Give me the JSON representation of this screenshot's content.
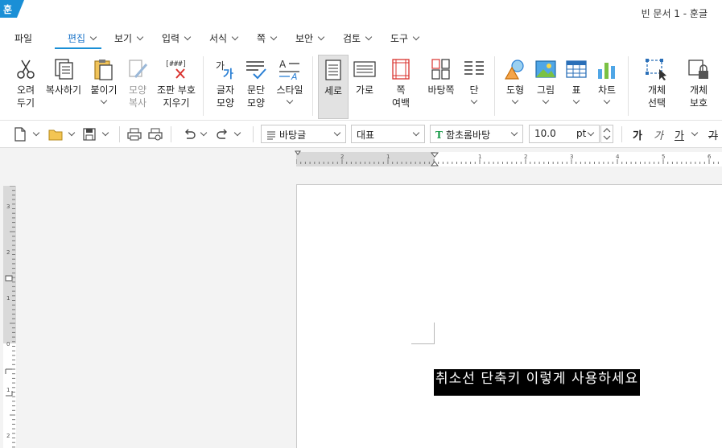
{
  "app": {
    "logo_text": "훈",
    "window_title": "빈 문서 1 - 훈글"
  },
  "menu": {
    "file": "파일",
    "items": [
      "편집",
      "보기",
      "입력",
      "서식",
      "쪽",
      "보안",
      "검토",
      "도구"
    ],
    "active": "편집"
  },
  "ribbon": {
    "cut": [
      "오려",
      "두기"
    ],
    "copy": "복사하기",
    "paste": "붙이기",
    "format_copy": [
      "모양",
      "복사"
    ],
    "clear_marks": [
      "조판 부호",
      "지우기"
    ],
    "clear_marks_icon_text": "[###]",
    "char_shape": [
      "글자",
      "모양"
    ],
    "char_icon_text": "가",
    "para_shape": [
      "문단",
      "모양"
    ],
    "style": "스타일",
    "portrait": "세로",
    "landscape": "가로",
    "page_margin": [
      "쪽",
      "여백"
    ],
    "background": "바탕쪽",
    "columns": "단",
    "shapes": "도형",
    "picture": "그림",
    "table": "표",
    "chart": "차트",
    "object_select": [
      "개체",
      "선택"
    ],
    "object_protect": [
      "개체",
      "보호"
    ]
  },
  "toolbar": {
    "style_combo": "바탕글",
    "lang_combo": "대표",
    "font_combo": "함초롬바탕",
    "size_value": "10.0",
    "size_unit": "pt",
    "bold": "가",
    "italic": "가",
    "underline": "가",
    "strike": "가"
  },
  "rulers": {
    "h_left": [
      "2",
      "1"
    ],
    "h_right": [
      "1",
      "2",
      "3",
      "4",
      "5",
      "6"
    ],
    "v": [
      "3",
      "2",
      "1",
      "0",
      "1",
      "2"
    ]
  },
  "document": {
    "selected_text": "취소선 단축키 이렇게 사용하세요"
  }
}
